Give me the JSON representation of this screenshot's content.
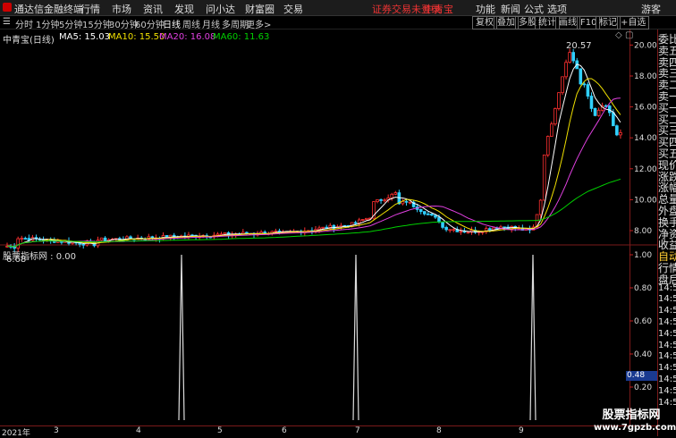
{
  "title_bar": {
    "app_name": "通达信金融终端",
    "menus": [
      "行情",
      "市场",
      "资讯",
      "发现",
      "问小达",
      "财富圈",
      "交易"
    ],
    "warning": "证券交易未登录",
    "stock": "中青宝",
    "right_menus": [
      "功能",
      "新闻",
      "公式",
      "选项",
      "游客"
    ]
  },
  "toolbar": {
    "periods": [
      "分时",
      "1分钟",
      "5分钟",
      "15分钟",
      "30分钟",
      "60分钟",
      "日线",
      "周线",
      "月线",
      "多周期",
      "更多>"
    ],
    "active_period": "日线",
    "buttons": [
      "复权",
      "叠加",
      "多股",
      "统计",
      "画线",
      "F10",
      "标记",
      "+自选"
    ]
  },
  "price_panel": {
    "header_name": "中青宝(日线)",
    "ma5": "MA5: 15.03",
    "ma10": "MA10: 15.50",
    "ma20": "MA20: 16.08",
    "ma60": "MA60: 11.63",
    "high_label": "20.57",
    "low_label": "6.68",
    "y_ticks": [
      "20.00",
      "18.00",
      "16.00",
      "14.00",
      "12.00",
      "10.00",
      "8.00"
    ],
    "colors": {
      "ma5": "#ffffff",
      "ma10": "#f0e000",
      "ma20": "#e040e0",
      "ma60": "#00d000",
      "up": "#ff3030",
      "down": "#30d0ff",
      "axis": "#c02020"
    }
  },
  "indicator_panel": {
    "header": "股票指标网 : 0.00",
    "y_ticks": [
      "1.00",
      "0.80",
      "0.60",
      "0.40",
      "0.20"
    ],
    "current_value": "0.48"
  },
  "x_axis": {
    "labels": [
      "2021年",
      "3",
      "4",
      "5",
      "6",
      "7",
      "8",
      "9"
    ]
  },
  "side_panel": {
    "items": [
      "委比",
      "卖五",
      "卖四",
      "卖三",
      "卖二",
      "卖一",
      "买一",
      "买二",
      "买三",
      "买四",
      "买五",
      "现价",
      "涨跌",
      "涨幅",
      "总量",
      "外盘",
      "换手",
      "净资",
      "收益",
      "自动",
      "行情",
      "盘后",
      "14:5",
      "14:5",
      "14:5",
      "14:5",
      "14:5",
      "14:5",
      "14:5",
      "14:5",
      "14:5",
      "14:5",
      "14:5"
    ]
  },
  "watermark": {
    "line1": "股票指标网",
    "line2": "www.7gpzb.com"
  },
  "chart_data": {
    "type": "candlestick",
    "spikes_at": [
      "2021-05",
      "2021-07",
      "2021-09"
    ],
    "annotations": [
      "20.57",
      "6.68"
    ]
  }
}
